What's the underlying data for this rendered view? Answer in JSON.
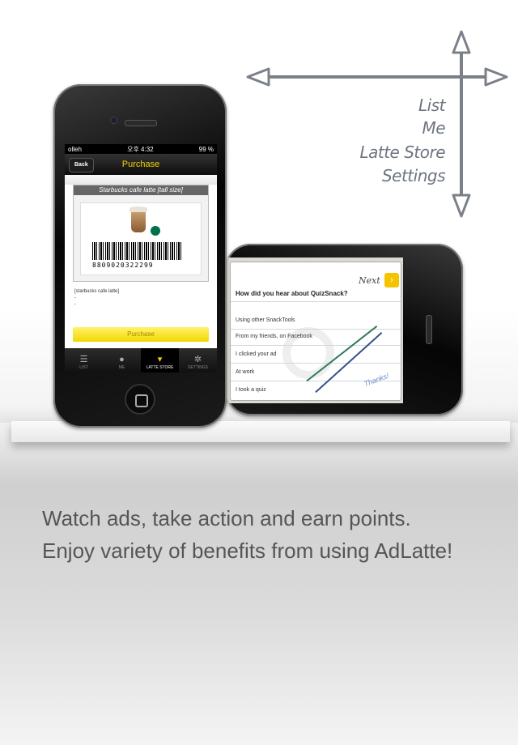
{
  "nav_labels": [
    "List",
    "Me",
    "Latte Store",
    "Settings"
  ],
  "phone_portrait": {
    "status": {
      "carrier": "olleh",
      "time": "오후 4:32",
      "battery": "99 %"
    },
    "nav": {
      "back": "Back",
      "title": "Purchase"
    },
    "ticket": {
      "title": "Starbucks cafe latte [tall size]",
      "barcode_number": "8809020322299"
    },
    "details": [
      "[starbucks cafe latte]",
      "-",
      "-"
    ],
    "purchase_label": "Purchase",
    "tabs": [
      {
        "label": "LIST",
        "icon": "list-icon"
      },
      {
        "label": "ME",
        "icon": "me-icon"
      },
      {
        "label": "LATTE STORE",
        "icon": "cart-icon",
        "active": true
      },
      {
        "label": "SETTINGS",
        "icon": "gear-icon"
      }
    ]
  },
  "phone_landscape": {
    "next_label": "Next",
    "question": "How did you hear about QuizSnack?",
    "answers": [
      "Using other SnackTools",
      "From my friends, on Facebook",
      "I clicked your ad",
      "At work",
      "I took a quiz"
    ],
    "thanks": "Thanks!"
  },
  "tagline": [
    "Watch ads, take action and earn points.",
    "Enjoy variety of benefits from using AdLatte!"
  ],
  "colors": {
    "accent_yellow": "#f4d400",
    "starbucks_green": "#00704a"
  }
}
